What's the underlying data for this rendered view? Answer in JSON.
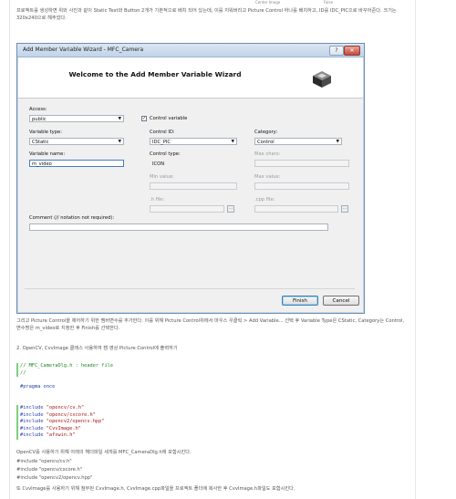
{
  "top_labels": {
    "left": "Center Image",
    "right": "False"
  },
  "intro": "프로젝트를 생성하면 위와 사진과 같이 Static Text와 Button 2개가 기본적으로 배치 되어 있는데, 이를 지워버리고 Picture Control 하나를 배치하고, ID를 IDC_PIC으로 바꾸어준다. 크기는 320x240으로 해주었다.",
  "dialog": {
    "title": "Add Member Variable Wizard - MFC_Camera",
    "help_glyph": "?",
    "close_glyph": "✕",
    "banner_title": "Welcome to the Add Member Variable Wizard",
    "access_label": "Access:",
    "access_value": "public",
    "control_variable_label": "Control variable",
    "control_variable_checked": true,
    "variable_type_label": "Variable type:",
    "variable_type_value": "CStatic",
    "control_id_label": "Control ID:",
    "control_id_value": "IDC_PIC",
    "category_label": "Category:",
    "category_value": "Control",
    "variable_name_label": "Variable name:",
    "variable_name_value": "m_video",
    "control_type_label": "Control type:",
    "control_type_value": "ICON",
    "max_chars_label": "Max chars:",
    "min_value_label": "Min value:",
    "max_value_label": "Max value:",
    "h_file_label": ".h file:",
    "cpp_file_label": ".cpp file:",
    "comment_label": "Comment (// notation not required):",
    "ellipsis": "...",
    "finish_label": "Finish",
    "cancel_label": "Cancel",
    "arrow": "▼"
  },
  "para2": "그리고 Picture Control을 제어하기 위한 멤버변수를 추가한다. 이를 위해 Picture Control위에서 마우스 우클릭 > Add Variable... 선택 후 Variable Type은 CStatic, Category는 Control, 변수명은 m_video로 지정한 후 Finish를 선택한다.",
  "para3": "2. OpenCV, CvvImage 클래스 사용하여 캠 영상 Picture Control에 출력하기",
  "code1": {
    "line1": "// MFC_CameraDlg.h : header file",
    "line2": "//",
    "line3": "#pragma once"
  },
  "code2": {
    "l1_kw": "#include",
    "l1_str": "\"opencv/cv.h\"",
    "l2_kw": "#include",
    "l2_str": "\"opencv/cxcore.h\"",
    "l3_kw": "#include",
    "l3_str": "\"opencv2/opencv.hpp\"",
    "l4_kw": "#include",
    "l4_str": "\"CvvImage.h\"",
    "l5_kw": "#include",
    "l5_str": "\"afxwin.h\""
  },
  "para4": "OpenCV를 사용하기 위해 아래의 헤더파일 세개를 MFC_CameraDlg.h에 포함시킨다.",
  "inc1": "#include \"opencv/cv.h\"",
  "inc2": "#include \"opencv/cxcore.h\"",
  "inc3": "#include \"opencv2/opencv.hpp\"",
  "para5": "또 CvvImage를 사용하기 위해 첨부된 CvvImage.h, CvvImage.cpp파일을 프로젝트 폴더에 복사한 후 CvvImage.h파일도 포함시킨다."
}
